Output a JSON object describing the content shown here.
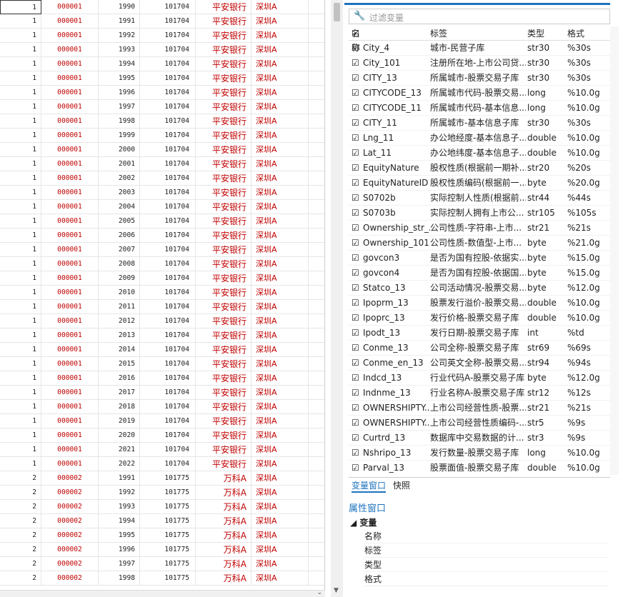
{
  "grid": {
    "rows": [
      [
        "1",
        "000001",
        "1990",
        "101704",
        "平安银行",
        "深圳A"
      ],
      [
        "1",
        "000001",
        "1991",
        "101704",
        "平安银行",
        "深圳A"
      ],
      [
        "1",
        "000001",
        "1992",
        "101704",
        "平安银行",
        "深圳A"
      ],
      [
        "1",
        "000001",
        "1993",
        "101704",
        "平安银行",
        "深圳A"
      ],
      [
        "1",
        "000001",
        "1994",
        "101704",
        "平安银行",
        "深圳A"
      ],
      [
        "1",
        "000001",
        "1995",
        "101704",
        "平安银行",
        "深圳A"
      ],
      [
        "1",
        "000001",
        "1996",
        "101704",
        "平安银行",
        "深圳A"
      ],
      [
        "1",
        "000001",
        "1997",
        "101704",
        "平安银行",
        "深圳A"
      ],
      [
        "1",
        "000001",
        "1998",
        "101704",
        "平安银行",
        "深圳A"
      ],
      [
        "1",
        "000001",
        "1999",
        "101704",
        "平安银行",
        "深圳A"
      ],
      [
        "1",
        "000001",
        "2000",
        "101704",
        "平安银行",
        "深圳A"
      ],
      [
        "1",
        "000001",
        "2001",
        "101704",
        "平安银行",
        "深圳A"
      ],
      [
        "1",
        "000001",
        "2002",
        "101704",
        "平安银行",
        "深圳A"
      ],
      [
        "1",
        "000001",
        "2003",
        "101704",
        "平安银行",
        "深圳A"
      ],
      [
        "1",
        "000001",
        "2004",
        "101704",
        "平安银行",
        "深圳A"
      ],
      [
        "1",
        "000001",
        "2005",
        "101704",
        "平安银行",
        "深圳A"
      ],
      [
        "1",
        "000001",
        "2006",
        "101704",
        "平安银行",
        "深圳A"
      ],
      [
        "1",
        "000001",
        "2007",
        "101704",
        "平安银行",
        "深圳A"
      ],
      [
        "1",
        "000001",
        "2008",
        "101704",
        "平安银行",
        "深圳A"
      ],
      [
        "1",
        "000001",
        "2009",
        "101704",
        "平安银行",
        "深圳A"
      ],
      [
        "1",
        "000001",
        "2010",
        "101704",
        "平安银行",
        "深圳A"
      ],
      [
        "1",
        "000001",
        "2011",
        "101704",
        "平安银行",
        "深圳A"
      ],
      [
        "1",
        "000001",
        "2012",
        "101704",
        "平安银行",
        "深圳A"
      ],
      [
        "1",
        "000001",
        "2013",
        "101704",
        "平安银行",
        "深圳A"
      ],
      [
        "1",
        "000001",
        "2014",
        "101704",
        "平安银行",
        "深圳A"
      ],
      [
        "1",
        "000001",
        "2015",
        "101704",
        "平安银行",
        "深圳A"
      ],
      [
        "1",
        "000001",
        "2016",
        "101704",
        "平安银行",
        "深圳A"
      ],
      [
        "1",
        "000001",
        "2017",
        "101704",
        "平安银行",
        "深圳A"
      ],
      [
        "1",
        "000001",
        "2018",
        "101704",
        "平安银行",
        "深圳A"
      ],
      [
        "1",
        "000001",
        "2019",
        "101704",
        "平安银行",
        "深圳A"
      ],
      [
        "1",
        "000001",
        "2020",
        "101704",
        "平安银行",
        "深圳A"
      ],
      [
        "1",
        "000001",
        "2021",
        "101704",
        "平安银行",
        "深圳A"
      ],
      [
        "1",
        "000001",
        "2022",
        "101704",
        "平安银行",
        "深圳A"
      ],
      [
        "2",
        "000002",
        "1991",
        "101775",
        "万科A",
        "深圳A"
      ],
      [
        "2",
        "000002",
        "1992",
        "101775",
        "万科A",
        "深圳A"
      ],
      [
        "2",
        "000002",
        "1993",
        "101775",
        "万科A",
        "深圳A"
      ],
      [
        "2",
        "000002",
        "1994",
        "101775",
        "万科A",
        "深圳A"
      ],
      [
        "2",
        "000002",
        "1995",
        "101775",
        "万科A",
        "深圳A"
      ],
      [
        "2",
        "000002",
        "1996",
        "101775",
        "万科A",
        "深圳A"
      ],
      [
        "2",
        "000002",
        "1997",
        "101775",
        "万科A",
        "深圳A"
      ],
      [
        "2",
        "000002",
        "1998",
        "101775",
        "万科A",
        "深圳A"
      ]
    ]
  },
  "variables": {
    "filter_placeholder": "过滤变量",
    "header": {
      "name": "名称",
      "label": "标签",
      "type": "类型",
      "format": "格式"
    },
    "header_check": "☑",
    "items": [
      {
        "check": "☑",
        "name": "City_4",
        "label": "城市-民营子库",
        "type": "str30",
        "format": "%30s"
      },
      {
        "check": "☑",
        "name": "City_101",
        "label": "注册所在地-上市公司贷...",
        "type": "str30",
        "format": "%30s"
      },
      {
        "check": "☑",
        "name": "CITY_13",
        "label": "所属城市-股票交易子库",
        "type": "str30",
        "format": "%30s"
      },
      {
        "check": "☑",
        "name": "CITYCODE_13",
        "label": "所属城市代码-股票交易...",
        "type": "long",
        "format": "%10.0g"
      },
      {
        "check": "☑",
        "name": "CITYCODE_11",
        "label": "所属城市代码-基本信息...",
        "type": "long",
        "format": "%10.0g"
      },
      {
        "check": "☑",
        "name": "CITY_11",
        "label": "所属城市-基本信息子库",
        "type": "str30",
        "format": "%30s"
      },
      {
        "check": "☑",
        "name": "Lng_11",
        "label": "办公地经度-基本信息子...",
        "type": "double",
        "format": "%10.0g"
      },
      {
        "check": "☑",
        "name": "Lat_11",
        "label": "办公地纬度-基本信息子...",
        "type": "double",
        "format": "%10.0g"
      },
      {
        "check": "☑",
        "name": "EquityNature",
        "label": "股权性质(根据前一期补...",
        "type": "str20",
        "format": "%20s"
      },
      {
        "check": "☑",
        "name": "EquityNatureID",
        "label": "股权性质编码(根据前一...",
        "type": "byte",
        "format": "%20.0g"
      },
      {
        "check": "☑",
        "name": "S0702b",
        "label": "实际控制人性质(根据前...",
        "type": "str44",
        "format": "%44s"
      },
      {
        "check": "☑",
        "name": "S0703b",
        "label": "实际控制人拥有上市公...",
        "type": "str105",
        "format": "%105s"
      },
      {
        "check": "☑",
        "name": "Ownership_str_...",
        "label": "公司性质-字符串-上市...",
        "type": "str21",
        "format": "%21s"
      },
      {
        "check": "☑",
        "name": "Ownership_101",
        "label": "公司性质-数值型-上市...",
        "type": "byte",
        "format": "%21.0g"
      },
      {
        "check": "☑",
        "name": "govcon3",
        "label": "是否为国有控股-依据实...",
        "type": "byte",
        "format": "%15.0g"
      },
      {
        "check": "☑",
        "name": "govcon4",
        "label": "是否为国有控股-依据国...",
        "type": "byte",
        "format": "%15.0g"
      },
      {
        "check": "☑",
        "name": "Statco_13",
        "label": "公司活动情况-股票交易...",
        "type": "byte",
        "format": "%12.0g"
      },
      {
        "check": "☑",
        "name": "Ipoprm_13",
        "label": "股票发行溢价-股票交易...",
        "type": "double",
        "format": "%10.0g"
      },
      {
        "check": "☑",
        "name": "Ipoprc_13",
        "label": "发行价格-股票交易子库",
        "type": "double",
        "format": "%10.0g"
      },
      {
        "check": "☑",
        "name": "Ipodt_13",
        "label": "发行日期-股票交易子库",
        "type": "int",
        "format": "%td"
      },
      {
        "check": "☑",
        "name": "Conme_13",
        "label": "公司全称-股票交易子库",
        "type": "str69",
        "format": "%69s"
      },
      {
        "check": "☑",
        "name": "Conme_en_13",
        "label": "公司英文全称-股票交易...",
        "type": "str94",
        "format": "%94s"
      },
      {
        "check": "☑",
        "name": "Indcd_13",
        "label": "行业代码A-股票交易子库",
        "type": "byte",
        "format": "%12.0g"
      },
      {
        "check": "☑",
        "name": "Indnme_13",
        "label": "行业名称A-股票交易子库",
        "type": "str12",
        "format": "%12s"
      },
      {
        "check": "☑",
        "name": "OWNERSHIPTY...",
        "label": "上市公司经营性质-股票...",
        "type": "str21",
        "format": "%21s"
      },
      {
        "check": "☑",
        "name": "OWNERSHIPTY...",
        "label": "上市公司经营性质编码-...",
        "type": "str5",
        "format": "%9s"
      },
      {
        "check": "☑",
        "name": "Curtrd_13",
        "label": "数据库中交易数据的计...",
        "type": "str3",
        "format": "%9s"
      },
      {
        "check": "☑",
        "name": "Nshripo_13",
        "label": "发行数量-股票交易子库",
        "type": "long",
        "format": "%10.0g"
      },
      {
        "check": "☑",
        "name": "Parval_13",
        "label": "股票面值-股票交易子库",
        "type": "double",
        "format": "%10.0g"
      }
    ]
  },
  "tabs": {
    "var_window": "变量窗口",
    "snapshot": "快照"
  },
  "properties": {
    "title": "属性窗口",
    "section": "变量",
    "section_arrow": "◢",
    "rows": [
      "名称",
      "标签",
      "类型",
      "格式"
    ]
  },
  "icons": {
    "filter": "wrench-icon"
  },
  "colors": {
    "accent": "#1e73be",
    "data_red": "#c00000"
  }
}
